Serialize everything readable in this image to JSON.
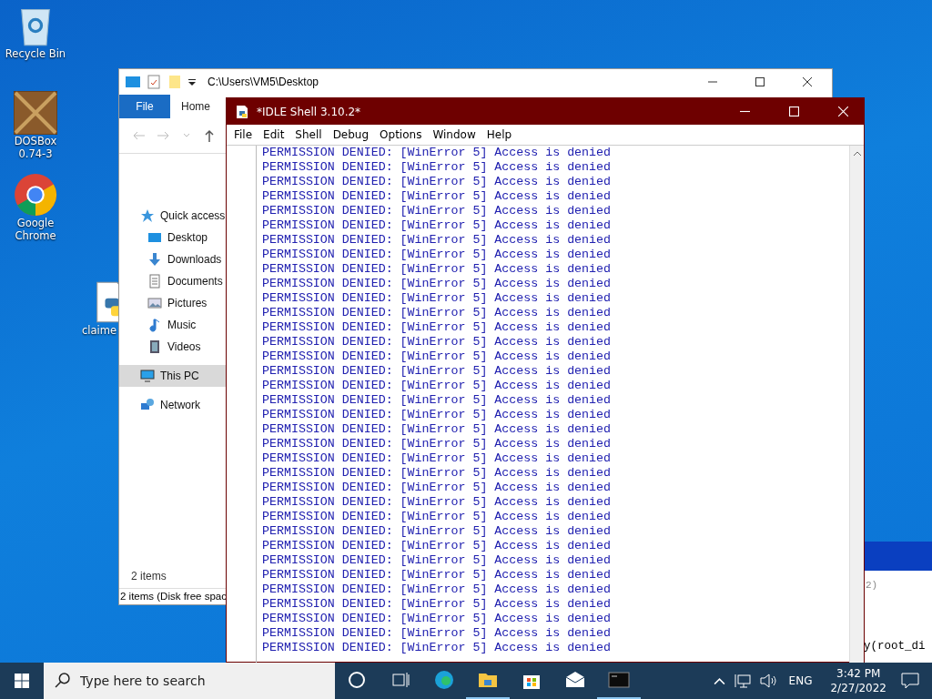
{
  "desktop_icons": [
    {
      "label": "Recycle Bin",
      "kind": "recycle"
    },
    {
      "label": "DOSBox 0.74-3",
      "kind": "dosbox"
    },
    {
      "label": "Google Chrome",
      "kind": "chrome"
    },
    {
      "label": "claime",
      "kind": "python"
    }
  ],
  "explorer": {
    "path": "C:\\Users\\VM5\\Desktop",
    "ribbon_tabs": [
      {
        "label": "File",
        "selected": true
      },
      {
        "label": "Home",
        "selected": false
      }
    ],
    "nav": [
      {
        "label": "Quick access",
        "kind": "star",
        "selected": false
      },
      {
        "label": "Desktop",
        "kind": "desktop",
        "selected": false
      },
      {
        "label": "Downloads",
        "kind": "download",
        "selected": false
      },
      {
        "label": "Documents",
        "kind": "document",
        "selected": false
      },
      {
        "label": "Pictures",
        "kind": "picture",
        "selected": false
      },
      {
        "label": "Music",
        "kind": "music",
        "selected": false
      },
      {
        "label": "Videos",
        "kind": "video",
        "selected": false
      },
      {
        "label": "This PC",
        "kind": "pc",
        "selected": true
      },
      {
        "label": "Network",
        "kind": "network",
        "selected": false
      }
    ],
    "item_count": "2 items",
    "status": "2 items (Disk free spac"
  },
  "back_window": {
    "lines": [
      "2)",
      "y(root_di"
    ]
  },
  "idle": {
    "title": "*IDLE Shell 3.10.2*",
    "menu": [
      "File",
      "Edit",
      "Shell",
      "Debug",
      "Options",
      "Window",
      "Help"
    ],
    "lines": [
      "PERMISSION DENIED: [WinError 5] Access is denied",
      "PERMISSION DENIED: [WinError 5] Access is denied",
      "PERMISSION DENIED: [WinError 5] Access is denied",
      "PERMISSION DENIED: [WinError 5] Access is denied",
      "PERMISSION DENIED: [WinError 5] Access is denied",
      "PERMISSION DENIED: [WinError 5] Access is denied",
      "PERMISSION DENIED: [WinError 5] Access is denied",
      "PERMISSION DENIED: [WinError 5] Access is denied",
      "PERMISSION DENIED: [WinError 5] Access is denied",
      "PERMISSION DENIED: [WinError 5] Access is denied",
      "PERMISSION DENIED: [WinError 5] Access is denied",
      "PERMISSION DENIED: [WinError 5] Access is denied",
      "PERMISSION DENIED: [WinError 5] Access is denied",
      "PERMISSION DENIED: [WinError 5] Access is denied",
      "PERMISSION DENIED: [WinError 5] Access is denied",
      "PERMISSION DENIED: [WinError 5] Access is denied",
      "PERMISSION DENIED: [WinError 5] Access is denied",
      "PERMISSION DENIED: [WinError 5] Access is denied",
      "PERMISSION DENIED: [WinError 5] Access is denied",
      "PERMISSION DENIED: [WinError 5] Access is denied",
      "PERMISSION DENIED: [WinError 5] Access is denied",
      "PERMISSION DENIED: [WinError 5] Access is denied",
      "PERMISSION DENIED: [WinError 5] Access is denied",
      "PERMISSION DENIED: [WinError 5] Access is denied",
      "PERMISSION DENIED: [WinError 5] Access is denied",
      "PERMISSION DENIED: [WinError 5] Access is denied",
      "PERMISSION DENIED: [WinError 5] Access is denied",
      "PERMISSION DENIED: [WinError 5] Access is denied",
      "PERMISSION DENIED: [WinError 5] Access is denied",
      "PERMISSION DENIED: [WinError 5] Access is denied",
      "PERMISSION DENIED: [WinError 5] Access is denied",
      "PERMISSION DENIED: [WinError 5] Access is denied",
      "PERMISSION DENIED: [WinError 5] Access is denied",
      "PERMISSION DENIED: [WinError 5] Access is denied",
      "PERMISSION DENIED: [WinError 5] Access is denied"
    ]
  },
  "taskbar": {
    "search_placeholder": "Type here to search",
    "apps": [
      {
        "kind": "cortana",
        "running": false
      },
      {
        "kind": "taskview",
        "running": false
      },
      {
        "kind": "edge",
        "running": false
      },
      {
        "kind": "folder",
        "running": true
      },
      {
        "kind": "store",
        "running": false
      },
      {
        "kind": "mail",
        "running": false
      },
      {
        "kind": "terminal",
        "running": true
      }
    ],
    "language": "ENG",
    "time": "3:42 PM",
    "date": "2/27/2022"
  }
}
